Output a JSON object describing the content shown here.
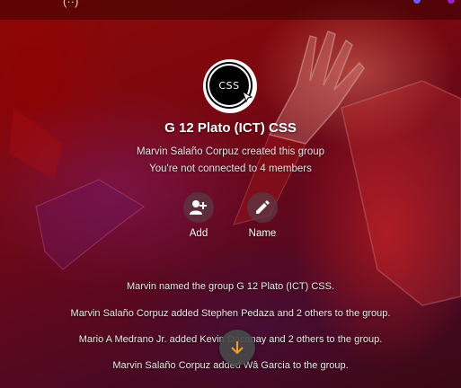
{
  "group": {
    "avatar_text": "CSS",
    "title": "G 12 Plato (ICT) CSS",
    "created_by": "Marvin Salaño Corpuz created this group",
    "connection_note": "You're not connected to 4 members"
  },
  "actions": [
    {
      "label": "Add",
      "icon": "add-person-icon"
    },
    {
      "label": "Name",
      "icon": "pencil-icon"
    }
  ],
  "events": [
    "Marvin named the group G 12 Plato (ICT) CSS.",
    "Marvin Salaño Corpuz added Stephen Pedaza and 2 others to the group.",
    "Mario A Medrano Jr. added Kevin Dacanay and 2 others to the group.",
    "Marvin Salaño Corpuz added Wâ Garcia to the group."
  ],
  "topbar": {
    "left_glyph": "(··)",
    "accent": "#6c5cff"
  },
  "scroll_button": {
    "icon": "arrow-down-icon",
    "accent": "#f0a030"
  },
  "colors": {
    "background": "#8a0a12",
    "text": "#ffffff"
  }
}
